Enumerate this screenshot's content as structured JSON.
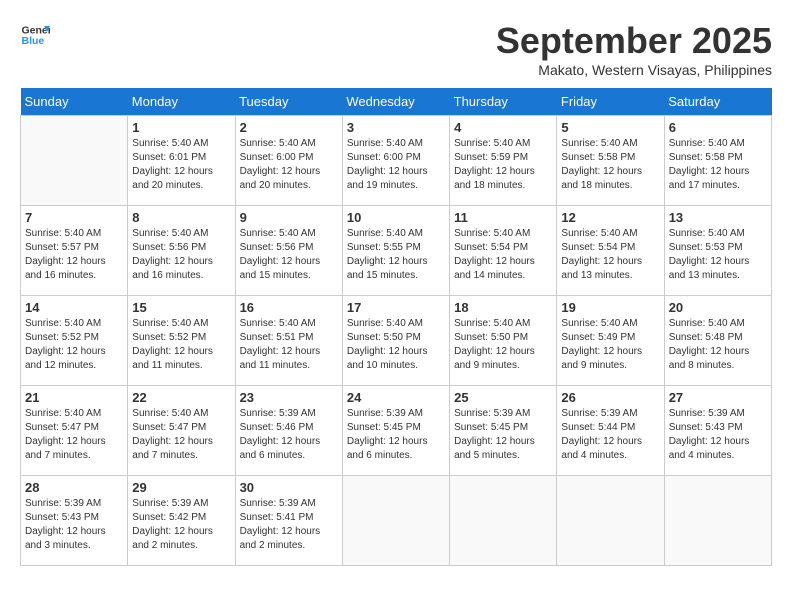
{
  "header": {
    "logo_line1": "General",
    "logo_line2": "Blue",
    "month": "September 2025",
    "location": "Makato, Western Visayas, Philippines"
  },
  "weekdays": [
    "Sunday",
    "Monday",
    "Tuesday",
    "Wednesday",
    "Thursday",
    "Friday",
    "Saturday"
  ],
  "weeks": [
    [
      {
        "day": "",
        "info": ""
      },
      {
        "day": "1",
        "info": "Sunrise: 5:40 AM\nSunset: 6:01 PM\nDaylight: 12 hours\nand 20 minutes."
      },
      {
        "day": "2",
        "info": "Sunrise: 5:40 AM\nSunset: 6:00 PM\nDaylight: 12 hours\nand 20 minutes."
      },
      {
        "day": "3",
        "info": "Sunrise: 5:40 AM\nSunset: 6:00 PM\nDaylight: 12 hours\nand 19 minutes."
      },
      {
        "day": "4",
        "info": "Sunrise: 5:40 AM\nSunset: 5:59 PM\nDaylight: 12 hours\nand 18 minutes."
      },
      {
        "day": "5",
        "info": "Sunrise: 5:40 AM\nSunset: 5:58 PM\nDaylight: 12 hours\nand 18 minutes."
      },
      {
        "day": "6",
        "info": "Sunrise: 5:40 AM\nSunset: 5:58 PM\nDaylight: 12 hours\nand 17 minutes."
      }
    ],
    [
      {
        "day": "7",
        "info": "Sunrise: 5:40 AM\nSunset: 5:57 PM\nDaylight: 12 hours\nand 16 minutes."
      },
      {
        "day": "8",
        "info": "Sunrise: 5:40 AM\nSunset: 5:56 PM\nDaylight: 12 hours\nand 16 minutes."
      },
      {
        "day": "9",
        "info": "Sunrise: 5:40 AM\nSunset: 5:56 PM\nDaylight: 12 hours\nand 15 minutes."
      },
      {
        "day": "10",
        "info": "Sunrise: 5:40 AM\nSunset: 5:55 PM\nDaylight: 12 hours\nand 15 minutes."
      },
      {
        "day": "11",
        "info": "Sunrise: 5:40 AM\nSunset: 5:54 PM\nDaylight: 12 hours\nand 14 minutes."
      },
      {
        "day": "12",
        "info": "Sunrise: 5:40 AM\nSunset: 5:54 PM\nDaylight: 12 hours\nand 13 minutes."
      },
      {
        "day": "13",
        "info": "Sunrise: 5:40 AM\nSunset: 5:53 PM\nDaylight: 12 hours\nand 13 minutes."
      }
    ],
    [
      {
        "day": "14",
        "info": "Sunrise: 5:40 AM\nSunset: 5:52 PM\nDaylight: 12 hours\nand 12 minutes."
      },
      {
        "day": "15",
        "info": "Sunrise: 5:40 AM\nSunset: 5:52 PM\nDaylight: 12 hours\nand 11 minutes."
      },
      {
        "day": "16",
        "info": "Sunrise: 5:40 AM\nSunset: 5:51 PM\nDaylight: 12 hours\nand 11 minutes."
      },
      {
        "day": "17",
        "info": "Sunrise: 5:40 AM\nSunset: 5:50 PM\nDaylight: 12 hours\nand 10 minutes."
      },
      {
        "day": "18",
        "info": "Sunrise: 5:40 AM\nSunset: 5:50 PM\nDaylight: 12 hours\nand 9 minutes."
      },
      {
        "day": "19",
        "info": "Sunrise: 5:40 AM\nSunset: 5:49 PM\nDaylight: 12 hours\nand 9 minutes."
      },
      {
        "day": "20",
        "info": "Sunrise: 5:40 AM\nSunset: 5:48 PM\nDaylight: 12 hours\nand 8 minutes."
      }
    ],
    [
      {
        "day": "21",
        "info": "Sunrise: 5:40 AM\nSunset: 5:47 PM\nDaylight: 12 hours\nand 7 minutes."
      },
      {
        "day": "22",
        "info": "Sunrise: 5:40 AM\nSunset: 5:47 PM\nDaylight: 12 hours\nand 7 minutes."
      },
      {
        "day": "23",
        "info": "Sunrise: 5:39 AM\nSunset: 5:46 PM\nDaylight: 12 hours\nand 6 minutes."
      },
      {
        "day": "24",
        "info": "Sunrise: 5:39 AM\nSunset: 5:45 PM\nDaylight: 12 hours\nand 6 minutes."
      },
      {
        "day": "25",
        "info": "Sunrise: 5:39 AM\nSunset: 5:45 PM\nDaylight: 12 hours\nand 5 minutes."
      },
      {
        "day": "26",
        "info": "Sunrise: 5:39 AM\nSunset: 5:44 PM\nDaylight: 12 hours\nand 4 minutes."
      },
      {
        "day": "27",
        "info": "Sunrise: 5:39 AM\nSunset: 5:43 PM\nDaylight: 12 hours\nand 4 minutes."
      }
    ],
    [
      {
        "day": "28",
        "info": "Sunrise: 5:39 AM\nSunset: 5:43 PM\nDaylight: 12 hours\nand 3 minutes."
      },
      {
        "day": "29",
        "info": "Sunrise: 5:39 AM\nSunset: 5:42 PM\nDaylight: 12 hours\nand 2 minutes."
      },
      {
        "day": "30",
        "info": "Sunrise: 5:39 AM\nSunset: 5:41 PM\nDaylight: 12 hours\nand 2 minutes."
      },
      {
        "day": "",
        "info": ""
      },
      {
        "day": "",
        "info": ""
      },
      {
        "day": "",
        "info": ""
      },
      {
        "day": "",
        "info": ""
      }
    ]
  ]
}
